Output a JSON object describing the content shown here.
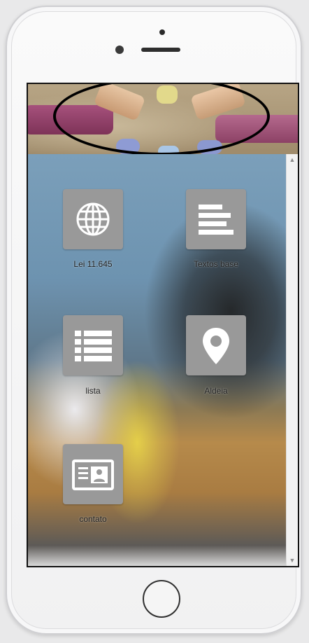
{
  "menu": {
    "items": [
      {
        "label": "Lei 11.645",
        "icon": "globe-icon"
      },
      {
        "label": "Textos base",
        "icon": "text-lines-icon"
      },
      {
        "label": "lista",
        "icon": "list-icon"
      },
      {
        "label": "Aldeia",
        "icon": "map-pin-icon"
      },
      {
        "label": "contato",
        "icon": "contact-card-icon"
      }
    ]
  },
  "scrollbar": {
    "up": "▲",
    "down": "▼"
  },
  "colors": {
    "tile": "#999999",
    "icon": "#ffffff",
    "label": "#222222",
    "ellipse": "#000000"
  }
}
